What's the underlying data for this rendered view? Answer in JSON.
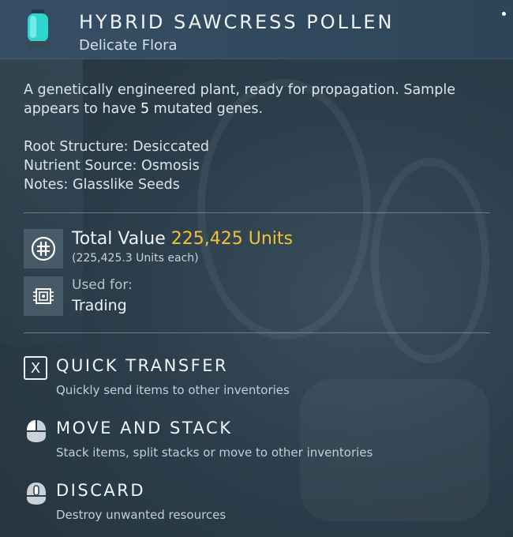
{
  "item": {
    "name": "HYBRID SAWCRESS POLLEN",
    "category": "Delicate Flora",
    "description_before": "A genetically engineered plant, ready for propagation. Sample appears to have ",
    "gene_count": "5",
    "description_after": " mutated genes."
  },
  "properties": [
    "Root Structure: Desiccated",
    "Nutrient Source: Osmosis",
    "Notes: Glasslike Seeds"
  ],
  "value": {
    "label": "Total Value",
    "amount": "225,425 Units",
    "each": "(225,425.3 Units each)"
  },
  "usage": {
    "label": "Used for:",
    "value": "Trading"
  },
  "actions": {
    "quick_transfer": {
      "key": "X",
      "title": "QUICK TRANSFER",
      "desc": "Quickly send items to other inventories"
    },
    "move_and_stack": {
      "title": "MOVE AND STACK",
      "desc": "Stack items, split stacks or move to other inventories"
    },
    "discard": {
      "title": "DISCARD",
      "desc": "Destroy unwanted resources"
    }
  },
  "colors": {
    "accent_value": "#f1c232",
    "header_bg": "#364f66",
    "panel_bg": "#2c3e4b"
  },
  "icons": {
    "item": "pollen-capsule-icon",
    "value": "currency-units-icon",
    "usage": "trade-chip-icon",
    "mouse": "mouse-icon"
  }
}
